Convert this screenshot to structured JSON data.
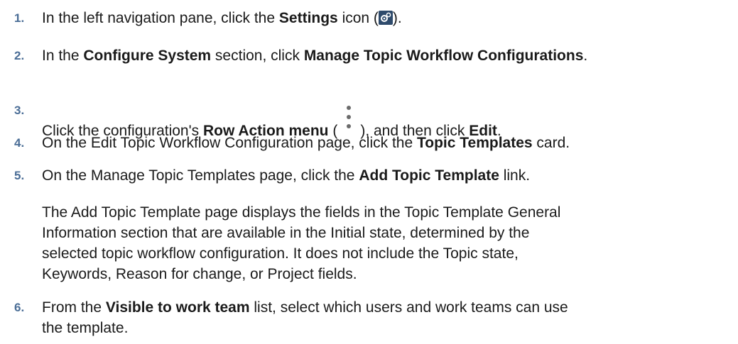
{
  "steps": [
    {
      "number": "1.",
      "before": "In the left navigation pane, click the ",
      "bold1": "Settings",
      "after1": " icon (",
      "icon": "settings-gear-icon",
      "after2": ")."
    },
    {
      "number": "2.",
      "before": "In the ",
      "bold1": "Configure System",
      "mid": " section, click ",
      "bold2": "Manage Topic Workflow Configurations",
      "after": "."
    },
    {
      "number": "3.",
      "before": "Click the configuration's ",
      "bold1": "Row Action menu",
      "mid1": " (",
      "icon": "kebab-menu-icon",
      "mid2": "), and then click ",
      "bold2": "Edit",
      "after": "."
    },
    {
      "number": "4.",
      "before": "On the Edit Topic Workflow Configuration page, click the ",
      "bold1": "Topic Templates",
      "after": " card."
    },
    {
      "number": "5.",
      "before": "On the Manage Topic Templates page, click the ",
      "bold1": "Add Topic Template",
      "after": " link."
    },
    {
      "number": "6.",
      "before": "From the ",
      "bold1": "Visible to work team",
      "after_line1": " list, select which users and work teams can use",
      "line2": "the template."
    }
  ],
  "note": {
    "line1": "The Add Topic Template page displays the fields in the Topic Template General",
    "line2": "Information section that are available in the Initial state, determined by the",
    "line3": "selected topic workflow configuration. It does not include the Topic state,",
    "line4": "Keywords, Reason for change, or Project fields."
  }
}
